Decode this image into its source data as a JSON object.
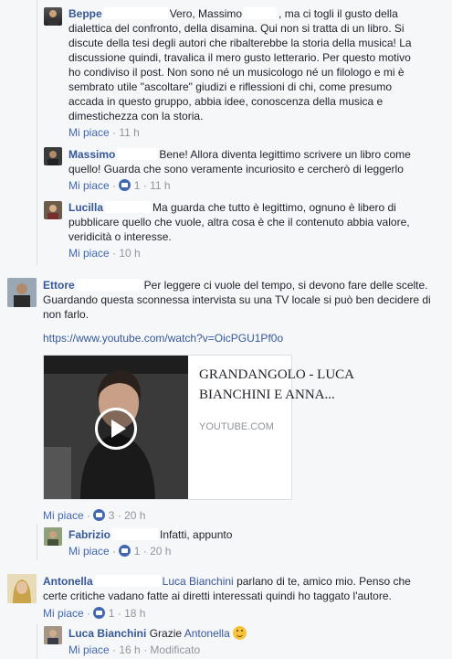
{
  "comments": [
    {
      "name": "Beppe",
      "text_a": "Vero, Massimo",
      "text_b": ", ma ci togli il gusto della dialettica del confronto, della disamina. Qui non si tratta di un libro. Si discute della tesi degli autori che ribalterebbe la storia della musica! La discussione quindi, travalica il mero gusto letterario. Per questo motivo ho condiviso il post. Non sono né un musicologo né un filologo e mi è sembrato utile \"ascoltare\" giudizi e riflessioni di chi, come presumo accada in questo gruppo, abbia idee, conoscenza della musica e dimestichezza con la storia.",
      "like": "Mi piace",
      "time": "11 h"
    },
    {
      "name": "Massimo",
      "text": "Bene! Allora diventa legittimo scrivere un libro come quello! Guarda che sono veramente incuriosito e cercherò di leggerlo",
      "like": "Mi piace",
      "reactions": "1",
      "time": "11 h"
    },
    {
      "name": "Lucilla",
      "text": "Ma guarda che tutto è legittimo, ognuno è libero di pubblicare quello che vuole, altra cosa è che il contenuto abbia valore, veridicità o interesse.",
      "like": "Mi piace",
      "time": "10 h"
    },
    {
      "name": "Ettore",
      "text": "Per leggere ci vuole del tempo, si devono fare delle scelte. Guardando questa sconnessa intervista su una TV locale si può ben decidere di non farlo.",
      "link": "https://www.youtube.com/watch?v=OicPGU1Pf0o",
      "preview_title": "GRANDANGOLO - LUCA BIANCHINI E ANNA...",
      "preview_domain": "YOUTUBE.COM",
      "like": "Mi piace",
      "reactions": "3",
      "time": "20 h"
    },
    {
      "name": "Fabrizio",
      "text": "Infatti, appunto",
      "like": "Mi piace",
      "reactions": "1",
      "time": "20 h"
    },
    {
      "name": "Antonella",
      "mention": "Luca Bianchini",
      "text": "parlano di te, amico mio. Penso che certe critiche vadano fatte ai diretti interessati quindi ho taggato l'autore.",
      "like": "Mi piace",
      "reactions": "1",
      "time": "18 h"
    },
    {
      "name": "Luca Bianchini",
      "text": "Grazie",
      "mention": "Antonella",
      "like": "Mi piace",
      "time": "16 h",
      "edited": "Modificato"
    }
  ],
  "separator": "·",
  "icons": {
    "like_badge": "like-icon",
    "play": "play-icon",
    "smile": "smile-emoji"
  },
  "colors": {
    "name": "#365899",
    "meta": "#90949c",
    "like_blue": "#4267b2"
  }
}
